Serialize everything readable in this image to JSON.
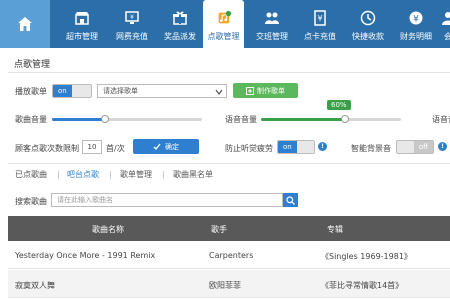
{
  "nav": {
    "items": [
      {
        "label": "超市管理",
        "icon": "store-icon"
      },
      {
        "label": "网费充值",
        "icon": "monitor-icon"
      },
      {
        "label": "奖品派发",
        "icon": "gift-icon"
      },
      {
        "label": "点歌管理",
        "icon": "music-request-icon"
      },
      {
        "label": "交班管理",
        "icon": "handover-icon"
      },
      {
        "label": "点卡充值",
        "icon": "card-recharge-icon"
      },
      {
        "label": "快捷收款",
        "icon": "quick-pay-icon"
      },
      {
        "label": "财务明细",
        "icon": "finance-icon"
      },
      {
        "label": "会",
        "icon": "member-icon"
      }
    ],
    "active_index": 3,
    "active_color": "#2c6ea8"
  },
  "page_title": "点歌管理",
  "playlist": {
    "label": "播放歌单",
    "toggle_on": "on",
    "select_placeholder": "请选择歌单",
    "make_button": "制作歌单"
  },
  "volume": {
    "song_label": "歌曲音量",
    "song_level": 0.35,
    "voice_label": "语音音量",
    "voice_level": 0.6,
    "voice_pct": "60%",
    "voice_label_2": "语音音"
  },
  "limits": {
    "label": "顾客点歌次数限制",
    "value": "10",
    "unit": "首/次",
    "confirm": "确定",
    "anti_fatigue_label": "防止听觉疲劳",
    "anti_fatigue_toggle": "on",
    "smart_bg_label": "智能背景音",
    "smart_bg_toggle": "off"
  },
  "subtabs": [
    "已点歌曲",
    "吧台点歌",
    "歌单管理",
    "歌曲黑名单"
  ],
  "subtab_active": 1,
  "search": {
    "label": "搜索歌曲",
    "placeholder": "请在此输入歌曲名"
  },
  "table": {
    "headers": [
      "歌曲名称",
      "歌手",
      "专辑"
    ],
    "rows": [
      [
        "Yesterday Once More - 1991 Remix",
        "Carpenters",
        "《Singles 1969-1981》"
      ],
      [
        "寂寞双人舞",
        "欧阳菲菲",
        "《菲比寻常情歌14首》"
      ]
    ]
  },
  "colors": {
    "accent_blue": "#2f7fd0",
    "green": "#5cb85c",
    "header_dark": "#595959"
  }
}
